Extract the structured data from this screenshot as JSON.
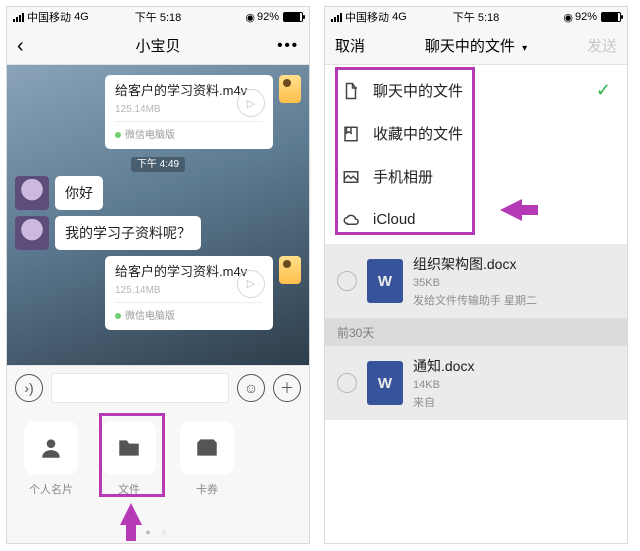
{
  "status": {
    "carrier": "中国移动",
    "network": "4G",
    "time": "下午 5:18",
    "battery_pct": "92%",
    "rec_icon": "◉"
  },
  "left": {
    "title": "小宝贝",
    "file_msg": {
      "name": "给客户的学习资料.m4v",
      "size": "125.14MB",
      "source": "微信电脑版"
    },
    "ts1": "下午 4:49",
    "m1": "你好",
    "m2": "我的学习子资料呢？",
    "attach": {
      "card": "个人名片",
      "file": "文件",
      "coupon": "卡券"
    }
  },
  "right": {
    "cancel": "取消",
    "drop_title": "聊天中的文件",
    "send": "发送",
    "options": {
      "chat": "聊天中的文件",
      "fav": "收藏中的文件",
      "album": "手机相册",
      "icloud": "iCloud"
    },
    "file1": {
      "name": "组织架构图.docx",
      "size": "35KB",
      "sub": "发给文件传输助手  星期二"
    },
    "section": "前30天",
    "file2": {
      "name": "通知.docx",
      "size": "14KB",
      "sub": "来自"
    }
  }
}
